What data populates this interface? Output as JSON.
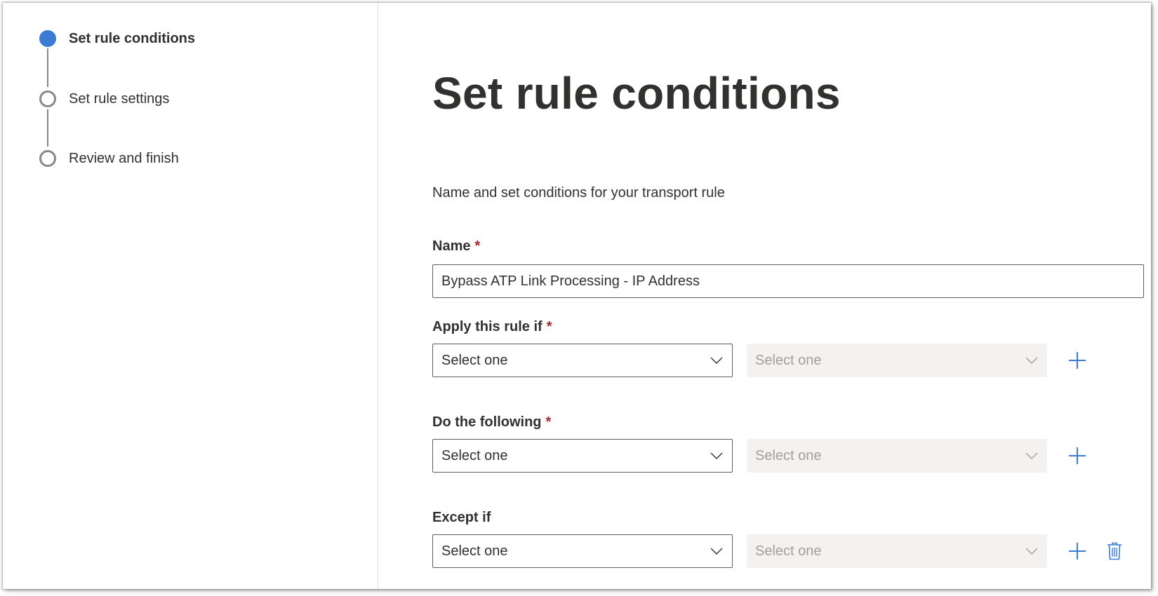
{
  "steps": [
    {
      "label": "Set rule conditions",
      "state": "active"
    },
    {
      "label": "Set rule settings",
      "state": "pending"
    },
    {
      "label": "Review and finish",
      "state": "pending"
    }
  ],
  "main": {
    "title": "Set rule conditions",
    "description": "Name and set conditions for your transport rule",
    "name_field": {
      "label": "Name",
      "required_mark": "*",
      "value": "Bypass ATP Link Processing - IP Address"
    },
    "apply_if": {
      "label": "Apply this rule if",
      "required_mark": "*",
      "primary_value": "Select one",
      "secondary_value": "Select one"
    },
    "do_following": {
      "label": "Do the following",
      "required_mark": "*",
      "primary_value": "Select one",
      "secondary_value": "Select one"
    },
    "except_if": {
      "label": "Except if",
      "primary_value": "Select one",
      "secondary_value": "Select one"
    }
  },
  "icons": {
    "add": "plus-icon",
    "delete": "trash-icon",
    "dropdown": "chevron-down-icon"
  },
  "colors": {
    "accent": "#3a7bd5",
    "required": "#a4262c",
    "disabled_bg": "#f3f2f1",
    "disabled_text": "#a19f9d"
  }
}
